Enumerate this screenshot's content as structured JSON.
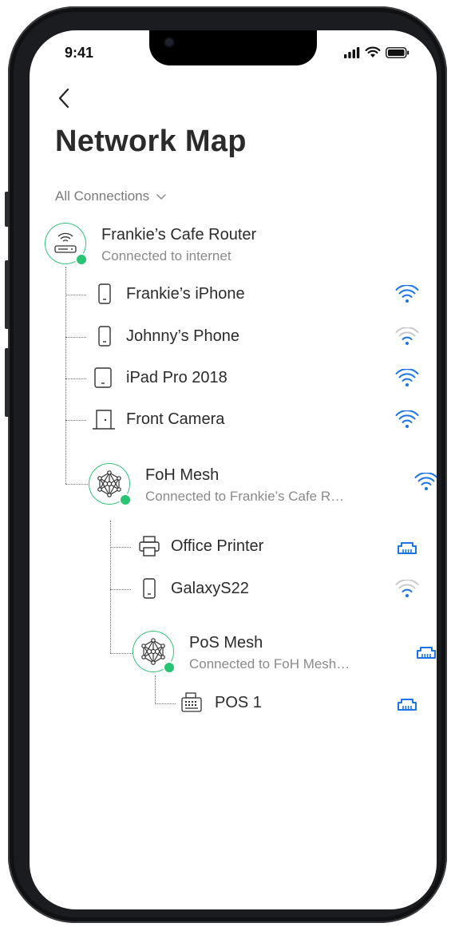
{
  "status_bar": {
    "time": "9:41"
  },
  "header": {
    "title": "Network Map"
  },
  "filter": {
    "label": "All Connections"
  },
  "router": {
    "name": "Frankie’s Cafe Router",
    "status": "Connected to internet"
  },
  "devices_router": [
    {
      "name": "Frankie’s iPhone",
      "icon": "phone-icon",
      "signal": "wifi-strong"
    },
    {
      "name": "Johnny’s Phone",
      "icon": "phone-icon",
      "signal": "wifi-weak"
    },
    {
      "name": "iPad Pro 2018",
      "icon": "tablet-icon",
      "signal": "wifi-strong"
    },
    {
      "name": "Front Camera",
      "icon": "door-camera-icon",
      "signal": "wifi-strong"
    }
  ],
  "foh_mesh": {
    "name": "FoH Mesh",
    "status": "Connected to Frankie’s Cafe R…",
    "signal": "wifi-strong"
  },
  "devices_foh": [
    {
      "name": "Office Printer",
      "icon": "printer-icon",
      "signal": "ethernet"
    },
    {
      "name": "GalaxyS22",
      "icon": "phone-icon",
      "signal": "wifi-weak"
    }
  ],
  "pos_mesh": {
    "name": "PoS Mesh",
    "status": "Connected to FoH Mesh…",
    "signal": "ethernet"
  },
  "devices_pos": [
    {
      "name": "POS 1",
      "icon": "cash-register-icon",
      "signal": "ethernet"
    }
  ],
  "colors": {
    "accent_blue": "#1a73e8",
    "online_green": "#29c473",
    "weak_signal": "#c9c9c9"
  }
}
